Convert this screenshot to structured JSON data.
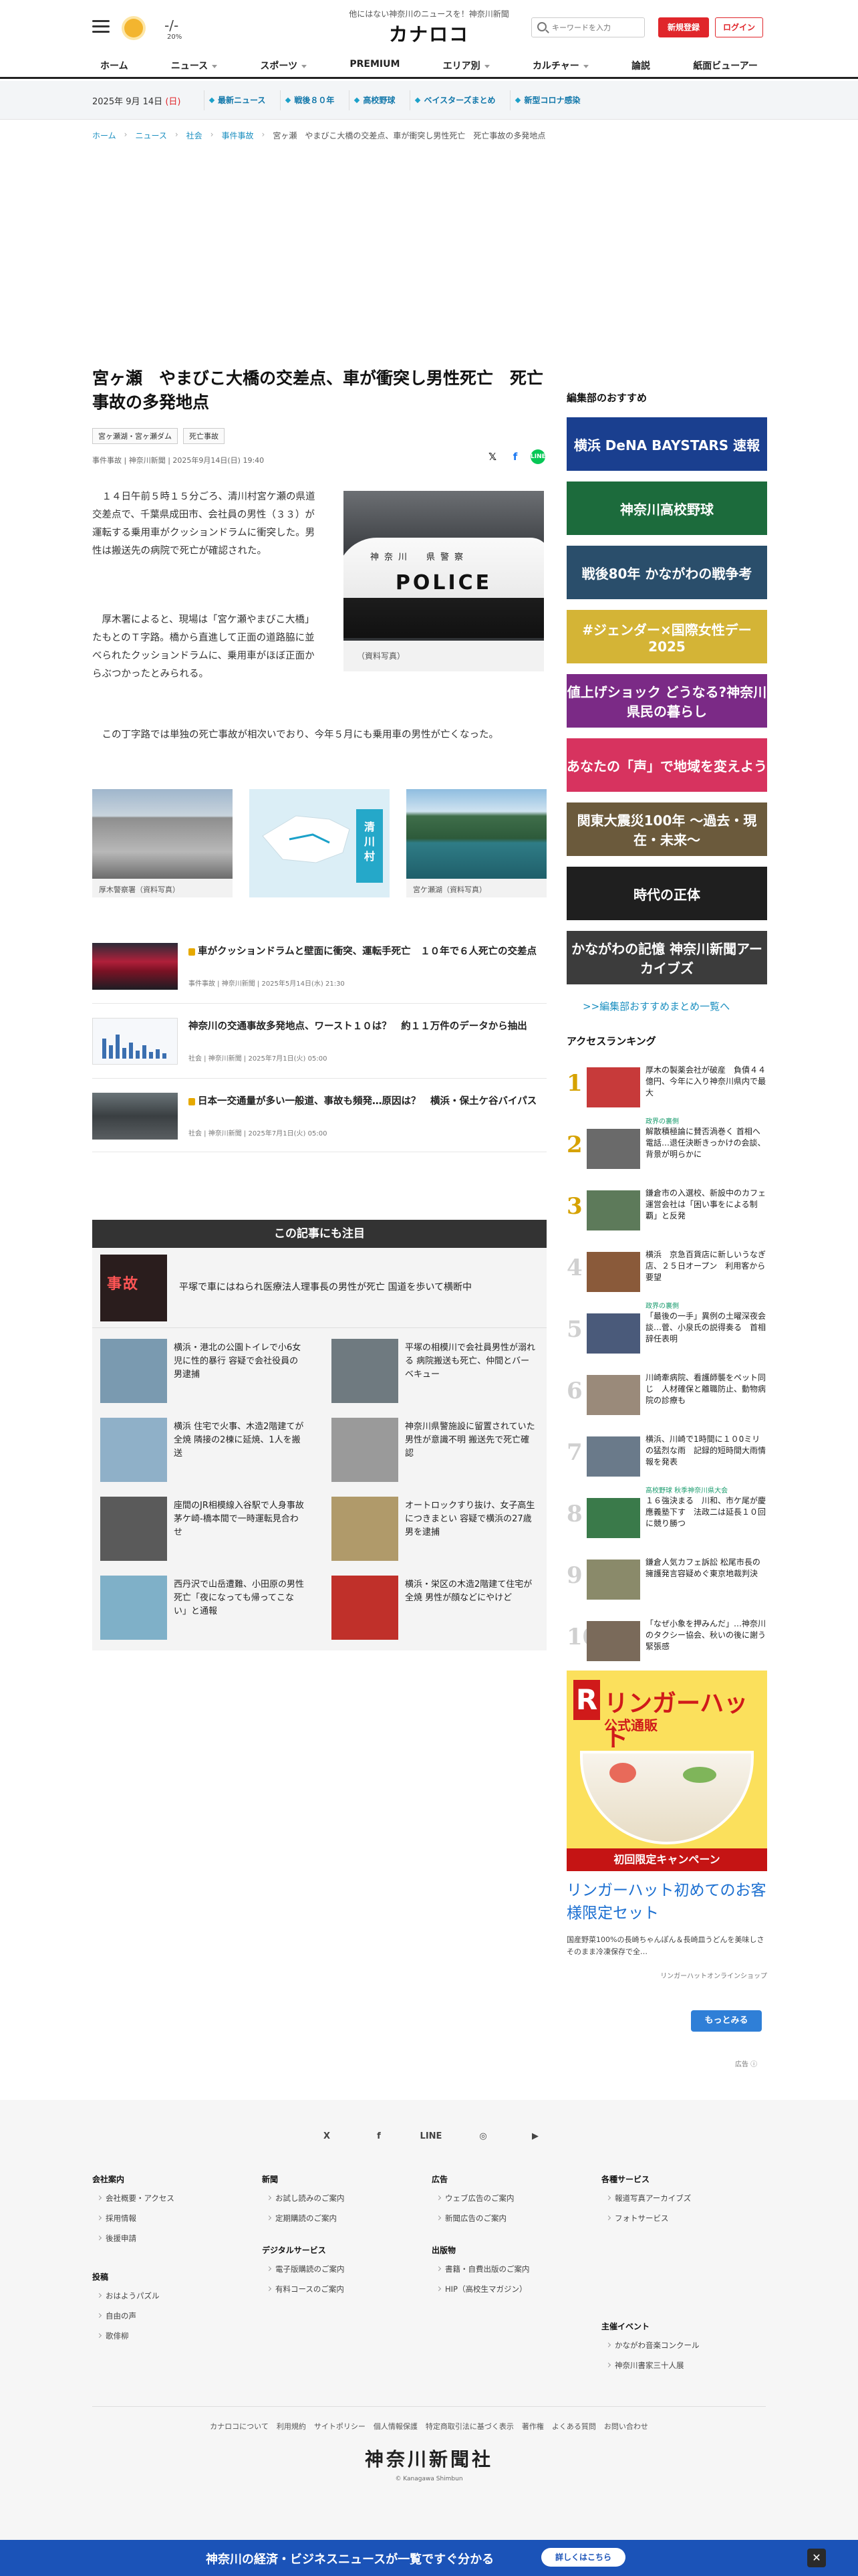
{
  "header": {
    "tagline": "他にはない神奈川のニュースを！神奈川新聞",
    "logo": "カナロコ",
    "weather": {
      "temp_high": "-/-",
      "temp_low": "20%"
    },
    "search_placeholder": "キーワードを入力",
    "signup": "新規登録",
    "login": "ログイン",
    "nav": [
      "ホーム",
      "ニュース",
      "スポーツ",
      "PREMIUM",
      "エリア別",
      "カルチャー",
      "論説",
      "紙面ビューアー"
    ],
    "nav_dropdown": [
      false,
      true,
      true,
      false,
      true,
      true,
      false,
      false
    ]
  },
  "datebar": {
    "date": "2025年 9月 14日",
    "dow": "(日)",
    "topics": [
      "最新ニュース",
      "戦後８０年",
      "高校野球",
      "ベイスターズまとめ",
      "新型コロナ感染"
    ]
  },
  "breadcrumb": [
    "ホーム",
    "ニュース",
    "社会",
    "事件事故",
    "宮ヶ瀬　やまびこ大橋の交差点、車が衝突し男性死亡　死亡事故の多発地点"
  ],
  "article": {
    "title": "宮ヶ瀬　やまびこ大橋の交差点、車が衝突し男性死亡　死亡事故の多発地点",
    "tags": [
      "宮ヶ瀬湖・宮ヶ瀬ダム",
      "死亡事故"
    ],
    "meta": "事件事故 | 神奈川新聞 | 2025年9月14日(日) 19:40",
    "para1": "　１４日午前５時１５分ごろ、清川村宮ケ瀬の県道交差点で、千葉県成田市、会社員の男性（３３）が運転する乗用車がクッションドラムに衝突した。男性は搬送先の病院で死亡が確認された。",
    "para2": "　厚木署によると、現場は「宮ケ瀬やまびこ大橋」たもとのＴ字路。橋から直進して正面の道路脇に並べられたクッションドラムに、乗用車がほぼ正面からぶつかったとみられる。",
    "para3": "　この丁字路では単独の死亡事故が相次いでおり、今年５月にも乗用車の男性が亡くなった。",
    "photo_caption": "（資料写真）",
    "photo_police": "POLICE",
    "photo_kana": "神奈川　県警察",
    "thumbs": [
      {
        "caption": "厚木警察署（資料写真）"
      },
      {
        "caption": "清川村",
        "map": true
      },
      {
        "caption": "宮ケ瀬湖（資料写真）"
      }
    ],
    "related": [
      {
        "title": "車がクッションドラムと壁面に衝突、運転手死亡　１０年で６人死亡の交差点",
        "meta": "事件事故 | 神奈川新聞 | 2025年5月14日(水) 21:30",
        "locked": true
      },
      {
        "title": "神奈川の交通事故多発地点、ワースト１０は？　約１１万件のデータから抽出",
        "meta": "社会 | 神奈川新聞 | 2025年7月1日(火) 05:00",
        "locked": false
      },
      {
        "title": "日本一交通量が多い一般道、事故も頻発…原因は？　横浜・保土ケ谷バイパス",
        "meta": "社会 | 神奈川新聞 | 2025年7月1日(火) 05:00",
        "locked": true
      }
    ]
  },
  "attention": {
    "heading": "この記事にも注目",
    "first": {
      "title": "平塚で車にはねられ医療法人理事長の男性が死亡 国道を歩いて横断中",
      "img_text": "事故"
    },
    "cells": [
      "横浜・港北の公園トイレで小6女児に性的暴行 容疑で会社役員の男逮捕",
      "平塚の相模川で会社員男性が溺れる 病院搬送も死亡、仲間とバーベキュー",
      "横浜 住宅で火事、木造2階建てが全焼 隣接の2棟に延焼、1人を搬送",
      "神奈川県警施設に留置されていた男性が意識不明 搬送先で死亡確認",
      "座間のJR相模線入谷駅で人身事故 茅ケ崎-橋本間で一時運転見合わせ",
      "オートロックすり抜け、女子高生につきまとい 容疑で横浜の27歳男を逮捕",
      "西丹沢で山岳遭難、小田原の男性死亡「夜になっても帰ってこない」と通報",
      "横浜・栄区の木造2階建て住宅が全焼 男性が顔などにやけど"
    ]
  },
  "sidebar": {
    "pick_heading": "編集部のおすすめ",
    "banners": [
      {
        "text": "横浜 DeNA BAYSTARS 速報",
        "bg": "#1a3f8f"
      },
      {
        "text": "神奈川高校野球",
        "bg": "#1c6b3c"
      },
      {
        "text": "戦後80年 かながわの戦争考",
        "bg": "#2a4e6b"
      },
      {
        "text": "#ジェンダー×国際女性デー 2025",
        "bg": "#d4b436"
      },
      {
        "text": "値上げショック どうなる?神奈川県民の暮らし",
        "bg": "#7b2a86"
      },
      {
        "text": "あなたの「声」で地域を変えよう",
        "bg": "#d7335f"
      },
      {
        "text": "関東大震災100年 ～過去・現在・未来～",
        "bg": "#6b5a3c"
      },
      {
        "text": "時代の正体",
        "bg": "#1f1f1f"
      },
      {
        "text": "かながわの記憶 神奈川新聞アーカイブズ",
        "bg": "#3c3c3c"
      }
    ],
    "more_link": ">>編集部おすすめまとめ一覧へ",
    "rank_heading": "アクセスランキング",
    "ranking": [
      {
        "n": "1",
        "title": "厚木の製薬会社が破産　負債４４億円、今年に入り神奈川県内で最大",
        "label": ""
      },
      {
        "n": "2",
        "title": "解散積極論に賛否渦巻く 首相へ電話…退任決断きっかけの会談、背景が明らかに",
        "label": "政界の裏側"
      },
      {
        "n": "3",
        "title": "鎌倉市の入選校、新設中のカフェ運営会社は「困い事をによる制覇」と反発",
        "label": ""
      },
      {
        "n": "4",
        "title": "横浜　京急百貨店に新しいうなぎ店、２５日オープン　利用客から要望",
        "label": ""
      },
      {
        "n": "5",
        "title": "「最後の一手」異例の土曜深夜会談…菅、小泉氏の説得奏る　首相辞任表明",
        "label": "政界の裏側"
      },
      {
        "n": "6",
        "title": "川崎牽病院、看護師襲をペット同じ　人材確保と離職防止、動物病院の診療も",
        "label": ""
      },
      {
        "n": "7",
        "title": "横浜、川崎で1時間に１０0ミリの猛烈な雨　記録的短時間大雨情報を発表",
        "label": ""
      },
      {
        "n": "8",
        "title": "１６強決まる　川和、市ケ尾が慶應義塾下す　法政二は延長１０回に競り勝つ",
        "label": "高校野球 秋季神奈川県大会"
      },
      {
        "n": "9",
        "title": "鎌倉人気カフェ訴訟 松尾市長の擁護発言容疑めぐ東京地裁判決",
        "label": ""
      },
      {
        "n": "10",
        "title": "「なぜ小象を押みんだ」…神奈川のタクシー協会、秋いの後に謝う緊張感",
        "label": ""
      }
    ]
  },
  "ad": {
    "brand": "リンガーハット",
    "sub": "公式通販",
    "r": "R",
    "campaign": "初回限定キャンペーン",
    "title": "リンガーハット初めてのお客様限定セット",
    "desc": "国産野菜100%の長崎ちゃんぽん＆長崎皿うどんを美味しさそのまま冷凍保存で全…",
    "source": "リンガーハットオンラインショップ",
    "button": "もっとみる",
    "label": "広告 ⓘ"
  },
  "footer": {
    "social": [
      "X",
      "f",
      "LINE",
      "◎",
      "▶"
    ],
    "columns": [
      {
        "heading": "会社案内",
        "items": [
          "会社概要・アクセス",
          "採用情報",
          "後援申請"
        ]
      },
      {
        "heading": "新聞",
        "items": [
          "お試し読みのご案内",
          "定期購読のご案内"
        ]
      },
      {
        "heading": "広告",
        "items": [
          "ウェブ広告のご案内",
          "新聞広告のご案内"
        ]
      },
      {
        "heading": "各種サービス",
        "items": [
          "報道写真アーカイブズ",
          "フォトサービス"
        ]
      },
      {
        "heading": "投稿",
        "items": [
          "おはようパズル",
          "自由の声",
          "歌俳柳"
        ]
      },
      {
        "heading": "デジタルサービス",
        "items": [
          "電子版購読のご案内",
          "有料コースのご案内"
        ]
      },
      {
        "heading": "出版物",
        "items": [
          "書籍・自費出版のご案内",
          "HIP（高校生マガジン）"
        ]
      },
      {
        "heading": "主催イベント",
        "items": [
          "かながわ音楽コンクール",
          "神奈川書家三十人展"
        ]
      }
    ],
    "links": [
      "カナロコについて",
      "利用規約",
      "サイトポリシー",
      "個人情報保護",
      "特定商取引法に基づく表示",
      "著作権",
      "よくある質問",
      "お問い合わせ"
    ],
    "logo": "神奈川新聞社",
    "copyright": "© Kanagawa Shimbun"
  },
  "bottombar": {
    "text": "神奈川の経済・ビジネスニュースが一覧ですぐ分かる",
    "button": "詳しくはこちら",
    "close": "✕"
  }
}
